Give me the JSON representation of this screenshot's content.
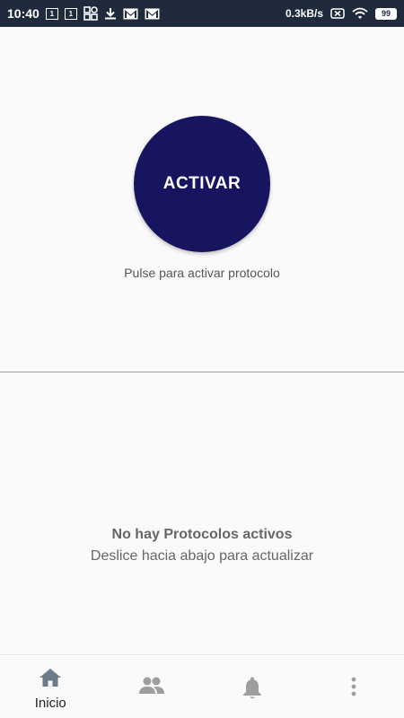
{
  "status_bar": {
    "time": "10:40",
    "notif_1": "1",
    "notif_2": "1",
    "speed": "0.3kB/s",
    "battery": "99"
  },
  "activate": {
    "button_label": "ACTIVAR",
    "hint": "Pulse para activar protocolo"
  },
  "empty_state": {
    "title": "No hay Protocolos activos",
    "subtitle": "Deslice hacia abajo para actualizar"
  },
  "bottom_nav": {
    "items": [
      {
        "label": "Inicio",
        "icon": "home-icon"
      },
      {
        "label": "",
        "icon": "people-icon"
      },
      {
        "label": "",
        "icon": "bell-icon"
      },
      {
        "label": "",
        "icon": "more-vert-icon"
      }
    ]
  },
  "colors": {
    "primary": "#171560",
    "status_bar": "#1f2a3d",
    "nav_icon": "#9e9e9e",
    "nav_active": "#6d7a8a"
  }
}
